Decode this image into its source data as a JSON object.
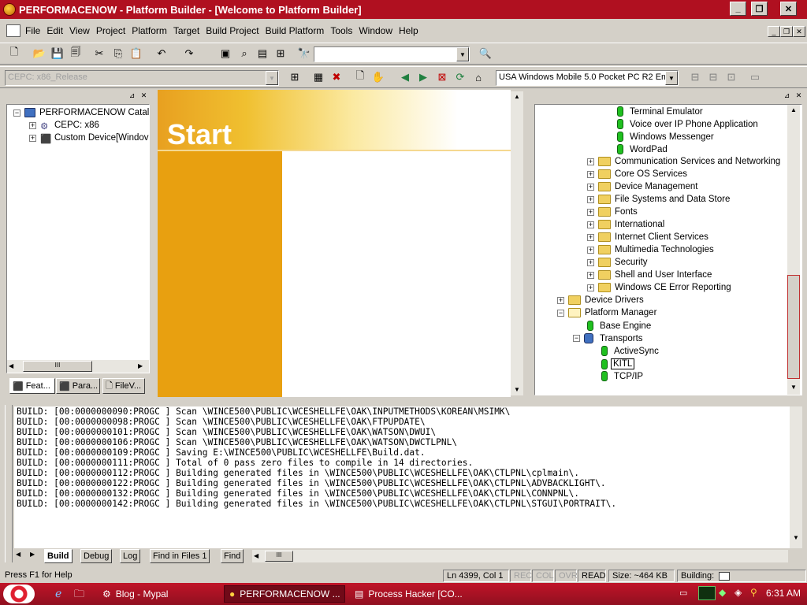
{
  "window": {
    "title": "PERFORMACENOW - Platform Builder - [Welcome to Platform Builder]"
  },
  "menu": [
    "File",
    "Edit",
    "View",
    "Project",
    "Platform",
    "Target",
    "Build Project",
    "Build Platform",
    "Tools",
    "Window",
    "Help"
  ],
  "toolbar": {
    "find_value": "",
    "config_combo": "CEPC: x86_Release",
    "locale_combo": "USA Windows Mobile 5.0 Pocket PC R2 Em"
  },
  "left_tree": {
    "root": "PERFORMACENOW Catal",
    "items": [
      "CEPC: x86",
      "Custom Device[Windov"
    ]
  },
  "left_tabs": [
    "Feat...",
    "Para...",
    "FileV..."
  ],
  "start_page": {
    "heading": "Start"
  },
  "catalog_tree": {
    "components_top": [
      "Terminal Emulator",
      "Voice over IP Phone Application",
      "Windows Messenger",
      "WordPad"
    ],
    "folders": [
      "Communication Services and Networking",
      "Core OS Services",
      "Device Management",
      "File Systems and Data Store",
      "Fonts",
      "International",
      "Internet Client Services",
      "Multimedia Technologies",
      "Security",
      "Shell and User Interface",
      "Windows CE Error Reporting"
    ],
    "device_drivers": "Device Drivers",
    "platform_manager": "Platform Manager",
    "base_engine": "Base Engine",
    "transports": "Transports",
    "transport_items": [
      "ActiveSync",
      "KITL",
      "TCP/IP"
    ]
  },
  "output": {
    "lines": [
      "BUILD: [00:0000000090:PROGC ] Scan \\WINCE500\\PUBLIC\\WCESHELLFE\\OAK\\INPUTMETHODS\\KOREAN\\MSIMK\\",
      "BUILD: [00:0000000098:PROGC ] Scan \\WINCE500\\PUBLIC\\WCESHELLFE\\OAK\\FTPUPDATE\\",
      "BUILD: [00:0000000101:PROGC ] Scan \\WINCE500\\PUBLIC\\WCESHELLFE\\OAK\\WATSON\\DWUI\\",
      "BUILD: [00:0000000106:PROGC ] Scan \\WINCE500\\PUBLIC\\WCESHELLFE\\OAK\\WATSON\\DWCTLPNL\\",
      "BUILD: [00:0000000109:PROGC ] Saving E:\\WINCE500\\PUBLIC\\WCESHELLFE\\Build.dat.",
      "BUILD: [00:0000000111:PROGC ] Total of 0 pass zero files to compile in 14 directories.",
      "BUILD: [00:0000000112:PROGC ] Building generated files in \\WINCE500\\PUBLIC\\WCESHELLFE\\OAK\\CTLPNL\\cplmain\\.",
      "BUILD: [00:0000000122:PROGC ] Building generated files in \\WINCE500\\PUBLIC\\WCESHELLFE\\OAK\\CTLPNL\\ADVBACKLIGHT\\.",
      "BUILD: [00:0000000132:PROGC ] Building generated files in \\WINCE500\\PUBLIC\\WCESHELLFE\\OAK\\CTLPNL\\CONNPNL\\.",
      "BUILD: [00:0000000142:PROGC ] Building generated files in \\WINCE500\\PUBLIC\\WCESHELLFE\\OAK\\CTLPNL\\STGUI\\PORTRAIT\\."
    ]
  },
  "output_tabs": [
    "Build",
    "Debug",
    "Log",
    "Find in Files 1",
    "Find"
  ],
  "status": {
    "help": "Press F1 for Help",
    "position": "Ln 4399, Col 1",
    "rec": "REC",
    "col": "COL",
    "ovr": "OVR",
    "read": "READ",
    "size": "Size: ~464 KB",
    "building": "Building:"
  },
  "taskbar": {
    "tasks": [
      "Blog - Mypal",
      "PERFORMACENOW ...",
      "Process Hacker [CO..."
    ],
    "clock": "6:31 AM"
  }
}
